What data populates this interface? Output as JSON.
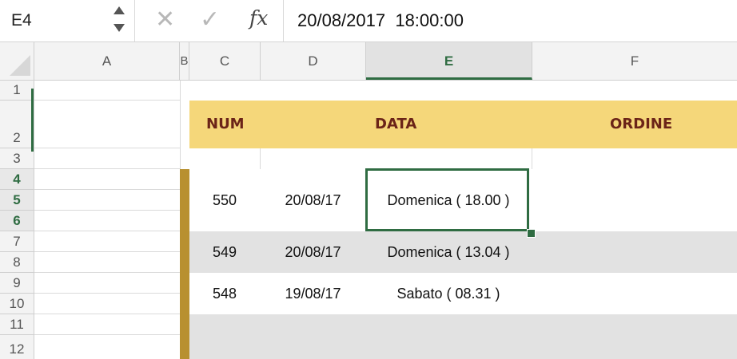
{
  "formula_bar": {
    "name_box": "E4",
    "cancel_icon": "✕",
    "confirm_icon": "✓",
    "fx_label": "fx",
    "formula": "20/08/2017  18:00:00"
  },
  "columns": [
    "A",
    "B",
    "C",
    "D",
    "E",
    "F"
  ],
  "active_column": "E",
  "rows": [
    "1",
    "2",
    "3",
    "4",
    "5",
    "6",
    "7",
    "8",
    "9",
    "10",
    "11",
    "12"
  ],
  "active_rows": [
    "4",
    "5",
    "6"
  ],
  "table": {
    "headers": {
      "num": "NUM",
      "data": "DATA",
      "ordine": "ORDINE"
    },
    "records": [
      {
        "num": "550",
        "date": "20/08/17",
        "day": "Domenica ( 18.00 )"
      },
      {
        "num": "549",
        "date": "20/08/17",
        "day": "Domenica ( 13.04 )"
      },
      {
        "num": "548",
        "date": "19/08/17",
        "day": "Sabato ( 08.31 )"
      }
    ]
  },
  "colors": {
    "accent_green": "#2f6c42",
    "header_band": "#f5d77a",
    "header_text": "#6b2418",
    "gold_bar": "#b89030",
    "zebra_gray": "#e2e2e2"
  }
}
